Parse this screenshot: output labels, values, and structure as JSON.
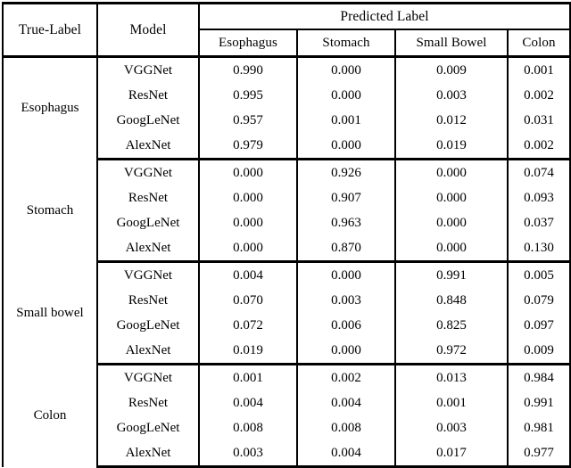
{
  "table": {
    "caption_header": {
      "true_label": "True-Label",
      "model": "Model",
      "predicted_label": "Predicted Label"
    },
    "predicted_columns": [
      "Esophagus",
      "Stomach",
      "Small Bowel",
      "Colon"
    ],
    "models": [
      "VGGNet",
      "ResNet",
      "GoogLeNet",
      "AlexNet"
    ],
    "groups": [
      {
        "true_label": "Esophagus",
        "rows": [
          {
            "model": "VGGNet",
            "values": [
              "0.990",
              "0.000",
              "0.009",
              "0.001"
            ]
          },
          {
            "model": "ResNet",
            "values": [
              "0.995",
              "0.000",
              "0.003",
              "0.002"
            ]
          },
          {
            "model": "GoogLeNet",
            "values": [
              "0.957",
              "0.001",
              "0.012",
              "0.031"
            ]
          },
          {
            "model": "AlexNet",
            "values": [
              "0.979",
              "0.000",
              "0.019",
              "0.002"
            ]
          }
        ]
      },
      {
        "true_label": "Stomach",
        "rows": [
          {
            "model": "VGGNet",
            "values": [
              "0.000",
              "0.926",
              "0.000",
              "0.074"
            ]
          },
          {
            "model": "ResNet",
            "values": [
              "0.000",
              "0.907",
              "0.000",
              "0.093"
            ]
          },
          {
            "model": "GoogLeNet",
            "values": [
              "0.000",
              "0.963",
              "0.000",
              "0.037"
            ]
          },
          {
            "model": "AlexNet",
            "values": [
              "0.000",
              "0.870",
              "0.000",
              "0.130"
            ]
          }
        ]
      },
      {
        "true_label": "Small bowel",
        "rows": [
          {
            "model": "VGGNet",
            "values": [
              "0.004",
              "0.000",
              "0.991",
              "0.005"
            ]
          },
          {
            "model": "ResNet",
            "values": [
              "0.070",
              "0.003",
              "0.848",
              "0.079"
            ]
          },
          {
            "model": "GoogLeNet",
            "values": [
              "0.072",
              "0.006",
              "0.825",
              "0.097"
            ]
          },
          {
            "model": "AlexNet",
            "values": [
              "0.019",
              "0.000",
              "0.972",
              "0.009"
            ]
          }
        ]
      },
      {
        "true_label": "Colon",
        "rows": [
          {
            "model": "VGGNet",
            "values": [
              "0.001",
              "0.002",
              "0.013",
              "0.984"
            ]
          },
          {
            "model": "ResNet",
            "values": [
              "0.004",
              "0.004",
              "0.001",
              "0.991"
            ]
          },
          {
            "model": "GoogLeNet",
            "values": [
              "0.008",
              "0.008",
              "0.003",
              "0.981"
            ]
          },
          {
            "model": "AlexNet",
            "values": [
              "0.003",
              "0.004",
              "0.017",
              "0.977"
            ]
          }
        ]
      }
    ]
  },
  "chart_data": {
    "type": "table",
    "title": "Confusion matrix: True-Label vs Predicted Label by model",
    "row_dimension": "True-Label",
    "secondary_dimension": "Model",
    "categories": [
      "Esophagus",
      "Stomach",
      "Small Bowel",
      "Colon"
    ],
    "models": [
      "VGGNet",
      "ResNet",
      "GoogLeNet",
      "AlexNet"
    ],
    "matrices": [
      {
        "model": "VGGNet",
        "rows": [
          {
            "true_label": "Esophagus",
            "values": [
              0.99,
              0.0,
              0.009,
              0.001
            ]
          },
          {
            "true_label": "Stomach",
            "values": [
              0.0,
              0.926,
              0.0,
              0.074
            ]
          },
          {
            "true_label": "Small bowel",
            "values": [
              0.004,
              0.0,
              0.991,
              0.005
            ]
          },
          {
            "true_label": "Colon",
            "values": [
              0.001,
              0.002,
              0.013,
              0.984
            ]
          }
        ]
      },
      {
        "model": "ResNet",
        "rows": [
          {
            "true_label": "Esophagus",
            "values": [
              0.995,
              0.0,
              0.003,
              0.002
            ]
          },
          {
            "true_label": "Stomach",
            "values": [
              0.0,
              0.907,
              0.0,
              0.093
            ]
          },
          {
            "true_label": "Small bowel",
            "values": [
              0.07,
              0.003,
              0.848,
              0.079
            ]
          },
          {
            "true_label": "Colon",
            "values": [
              0.004,
              0.004,
              0.001,
              0.991
            ]
          }
        ]
      },
      {
        "model": "GoogLeNet",
        "rows": [
          {
            "true_label": "Esophagus",
            "values": [
              0.957,
              0.001,
              0.012,
              0.031
            ]
          },
          {
            "true_label": "Stomach",
            "values": [
              0.0,
              0.963,
              0.0,
              0.037
            ]
          },
          {
            "true_label": "Small bowel",
            "values": [
              0.072,
              0.006,
              0.825,
              0.097
            ]
          },
          {
            "true_label": "Colon",
            "values": [
              0.008,
              0.008,
              0.003,
              0.981
            ]
          }
        ]
      },
      {
        "model": "AlexNet",
        "rows": [
          {
            "true_label": "Esophagus",
            "values": [
              0.979,
              0.0,
              0.019,
              0.002
            ]
          },
          {
            "true_label": "Stomach",
            "values": [
              0.0,
              0.87,
              0.0,
              0.13
            ]
          },
          {
            "true_label": "Small bowel",
            "values": [
              0.019,
              0.0,
              0.972,
              0.009
            ]
          },
          {
            "true_label": "Colon",
            "values": [
              0.003,
              0.004,
              0.017,
              0.977
            ]
          }
        ]
      }
    ]
  }
}
